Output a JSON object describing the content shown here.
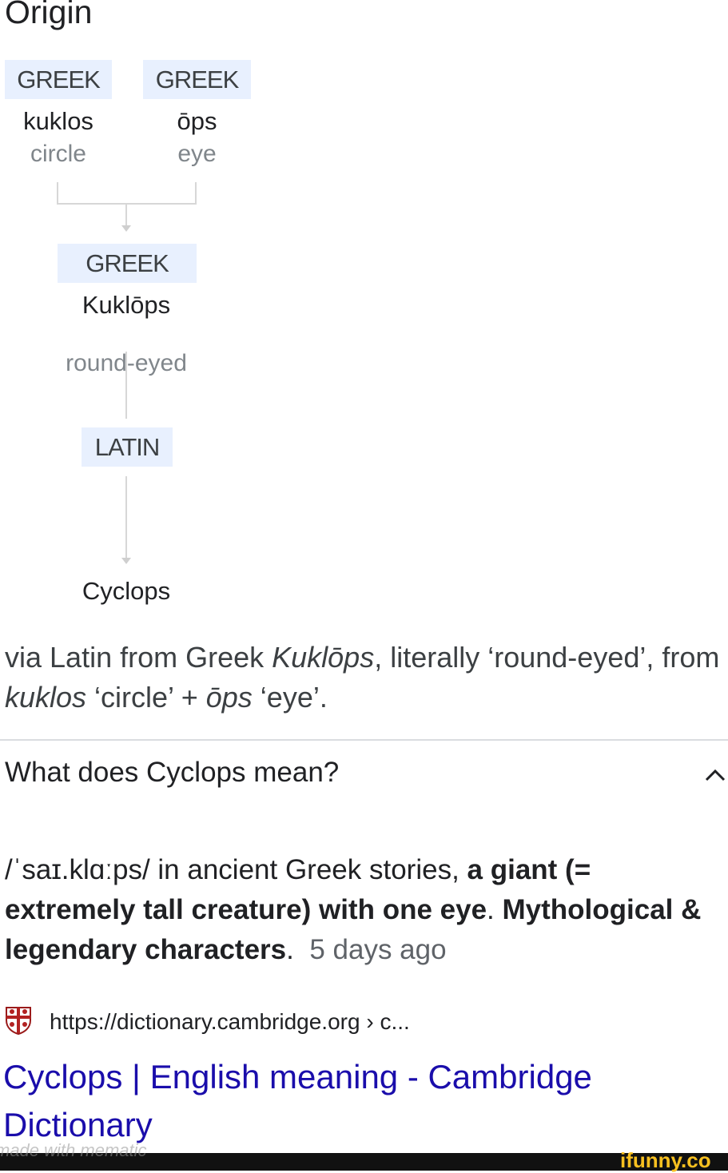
{
  "origin": {
    "heading": "Origin",
    "roots": [
      {
        "lang": "GREEK",
        "word": "kuklos",
        "gloss": "circle"
      },
      {
        "lang": "GREEK",
        "word": "ōps",
        "gloss": "eye"
      }
    ],
    "combined": {
      "lang": "GREEK",
      "word": "Kuklōps",
      "gloss": "round-eyed"
    },
    "intermediate": {
      "lang": "LATIN"
    },
    "result": {
      "word": "Cyclops"
    }
  },
  "etymology": {
    "p1": "via Latin from Greek ",
    "i1": "Kuklōps",
    "p2": ", literally ‘round-eyed’, from ",
    "i2": "kuklos",
    "p3": " ‘circle’ + ",
    "i3": "ōps",
    "p4": " ‘eye’."
  },
  "question": {
    "text": "What does Cyclops mean?",
    "icon": "chevron-up-icon"
  },
  "definition": {
    "pron": "/ˈsaɪ.klɑːps/ in ancient Greek stories, ",
    "b1": "a giant (= extremely tall creature) with one eye",
    "sep": ". ",
    "b2": "Mythological & legendary characters",
    "end": ".",
    "time": "5 days ago"
  },
  "source": {
    "icon": "cambridge-shield-icon",
    "url": "https://dictionary.cambridge.org › c...",
    "title": "Cyclops | English meaning - Cambridge Dictionary",
    "link_color": "#1a0dab"
  },
  "watermarks": {
    "left": "made with mematic",
    "right": "ifunny.co"
  }
}
